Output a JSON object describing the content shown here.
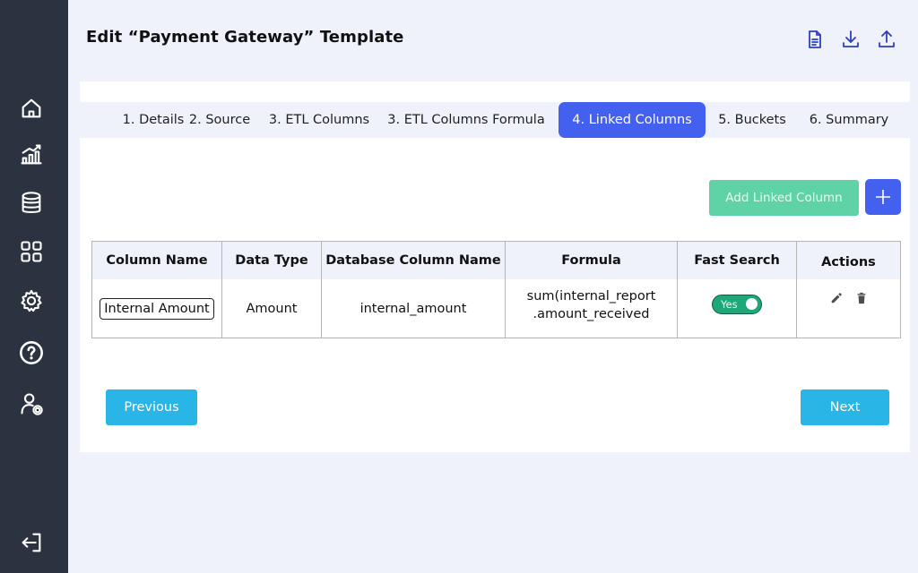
{
  "page": {
    "title": "Edit “Payment Gateway” Template"
  },
  "sidebar": {
    "items": [
      {
        "icon": "home-icon"
      },
      {
        "icon": "analytics-icon"
      },
      {
        "icon": "database-icon"
      },
      {
        "icon": "apps-grid-icon"
      },
      {
        "icon": "settings-gear-icon"
      },
      {
        "icon": "help-icon"
      },
      {
        "icon": "user-settings-icon"
      },
      {
        "icon": "logout-icon"
      }
    ]
  },
  "top_actions": [
    {
      "icon": "document-icon"
    },
    {
      "icon": "download-icon"
    },
    {
      "icon": "upload-icon"
    }
  ],
  "tabs": [
    {
      "label": "1. Details"
    },
    {
      "label": "2. Source"
    },
    {
      "label": "3. ETL Columns"
    },
    {
      "label": "3. ETL Columns Formula"
    },
    {
      "label": "4. Linked Columns",
      "active": true
    },
    {
      "label": "5. Buckets"
    },
    {
      "label": "6. Summary"
    }
  ],
  "toolbar": {
    "add_label": "Add Linked Column"
  },
  "table": {
    "headers": [
      "Column Name",
      "Data Type",
      "Database Column Name",
      "Formula",
      "Fast Search",
      "Actions"
    ],
    "rows": [
      {
        "column_name": "Internal Amount",
        "data_type": "Amount",
        "db_column": "internal_amount",
        "formula_line1": "sum(internal_report",
        "formula_line2": ".amount_received",
        "fast_search": "Yes"
      }
    ]
  },
  "footer": {
    "previous_label": "Previous",
    "next_label": "Next"
  },
  "colors": {
    "accent": "#4361ee",
    "sidebar": "#2b3340",
    "success": "#5fd3a6",
    "toggle": "#1ea779",
    "nav_button": "#29b5e5"
  }
}
